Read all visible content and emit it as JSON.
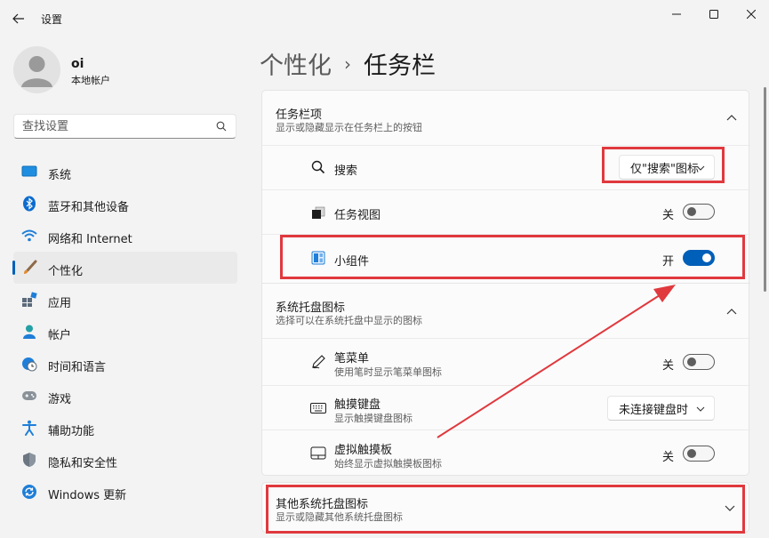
{
  "window": {
    "title": "设置"
  },
  "user": {
    "name": "oi",
    "account_type": "本地帐户"
  },
  "search": {
    "placeholder": "查找设置"
  },
  "sidebar": {
    "items": [
      {
        "label": "系统",
        "icon": "system-monitor-icon"
      },
      {
        "label": "蓝牙和其他设备",
        "icon": "bluetooth-icon"
      },
      {
        "label": "网络和 Internet",
        "icon": "wifi-icon"
      },
      {
        "label": "个性化",
        "icon": "brush-icon",
        "active": true
      },
      {
        "label": "应用",
        "icon": "apps-icon"
      },
      {
        "label": "帐户",
        "icon": "person-icon"
      },
      {
        "label": "时间和语言",
        "icon": "globe-clock-icon"
      },
      {
        "label": "游戏",
        "icon": "gamepad-icon"
      },
      {
        "label": "辅助功能",
        "icon": "accessibility-icon"
      },
      {
        "label": "隐私和安全性",
        "icon": "shield-icon"
      },
      {
        "label": "Windows 更新",
        "icon": "update-icon"
      }
    ]
  },
  "breadcrumb": {
    "parent": "个性化",
    "separator": "›",
    "current": "任务栏"
  },
  "taskbar_items": {
    "title": "任务栏项",
    "subtitle": "显示或隐藏显示在任务栏上的按钮",
    "rows": [
      {
        "label": "搜索",
        "icon": "search-icon",
        "control": "dropdown",
        "value": "仅\"搜索\"图标"
      },
      {
        "label": "任务视图",
        "icon": "task-view-icon",
        "control": "toggle",
        "state_label": "关",
        "on": false
      },
      {
        "label": "小组件",
        "icon": "widgets-icon",
        "control": "toggle",
        "state_label": "开",
        "on": true
      }
    ]
  },
  "tray_icons": {
    "title": "系统托盘图标",
    "subtitle": "选择可以在系统托盘中显示的图标",
    "rows": [
      {
        "label": "笔菜单",
        "sub": "使用笔时显示笔菜单图标",
        "icon": "pen-icon",
        "control": "toggle",
        "state_label": "关",
        "on": false
      },
      {
        "label": "触摸键盘",
        "sub": "显示触摸键盘图标",
        "icon": "keyboard-icon",
        "control": "dropdown",
        "value": "未连接键盘时"
      },
      {
        "label": "虚拟触摸板",
        "sub": "始终显示虚拟触摸板图标",
        "icon": "touchpad-icon",
        "control": "toggle",
        "state_label": "关",
        "on": false
      }
    ]
  },
  "other_tray": {
    "title": "其他系统托盘图标",
    "subtitle": "显示或隐藏其他系统托盘图标"
  },
  "colors": {
    "accent": "#005fb8",
    "annotation_red": "#e0393e"
  }
}
